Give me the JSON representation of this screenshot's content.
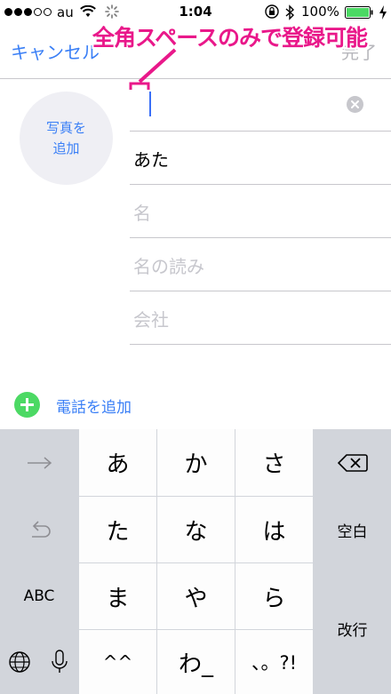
{
  "status_bar": {
    "carrier": "au",
    "time": "1:04",
    "battery_percent": "100%",
    "signal_dots_filled": 3,
    "signal_dots_total": 5
  },
  "nav": {
    "cancel_label": "キャンセル",
    "done_label": "完了"
  },
  "annotation": {
    "text": "全角スペースのみで登録可能",
    "color": "#e9188a"
  },
  "photo": {
    "label": "写真を\n追加"
  },
  "fields": [
    {
      "value": "",
      "placeholder": "",
      "focused": true
    },
    {
      "value": "あた",
      "placeholder": ""
    },
    {
      "value": "",
      "placeholder": "名"
    },
    {
      "value": "",
      "placeholder": "名の読み"
    },
    {
      "value": "",
      "placeholder": "会社"
    }
  ],
  "add_phone": {
    "label": "電話を追加"
  },
  "keyboard": {
    "rows": [
      [
        "→",
        "あ",
        "か",
        "さ",
        "⌫"
      ],
      [
        "↺",
        "た",
        "な",
        "は",
        "空白"
      ],
      [
        "ABC",
        "ま",
        "や",
        "ら",
        "改行"
      ],
      [
        "globe",
        "mic",
        "^^",
        "わ_",
        "、。?!"
      ]
    ],
    "special": {
      "space": "空白",
      "return": "改行",
      "abc": "ABC",
      "emoticon": "^^",
      "wa": "わ_",
      "punct": "、。?!"
    }
  },
  "colors": {
    "accent": "#3a7ff6",
    "add_green": "#4cd964",
    "annotation": "#e9188a"
  }
}
